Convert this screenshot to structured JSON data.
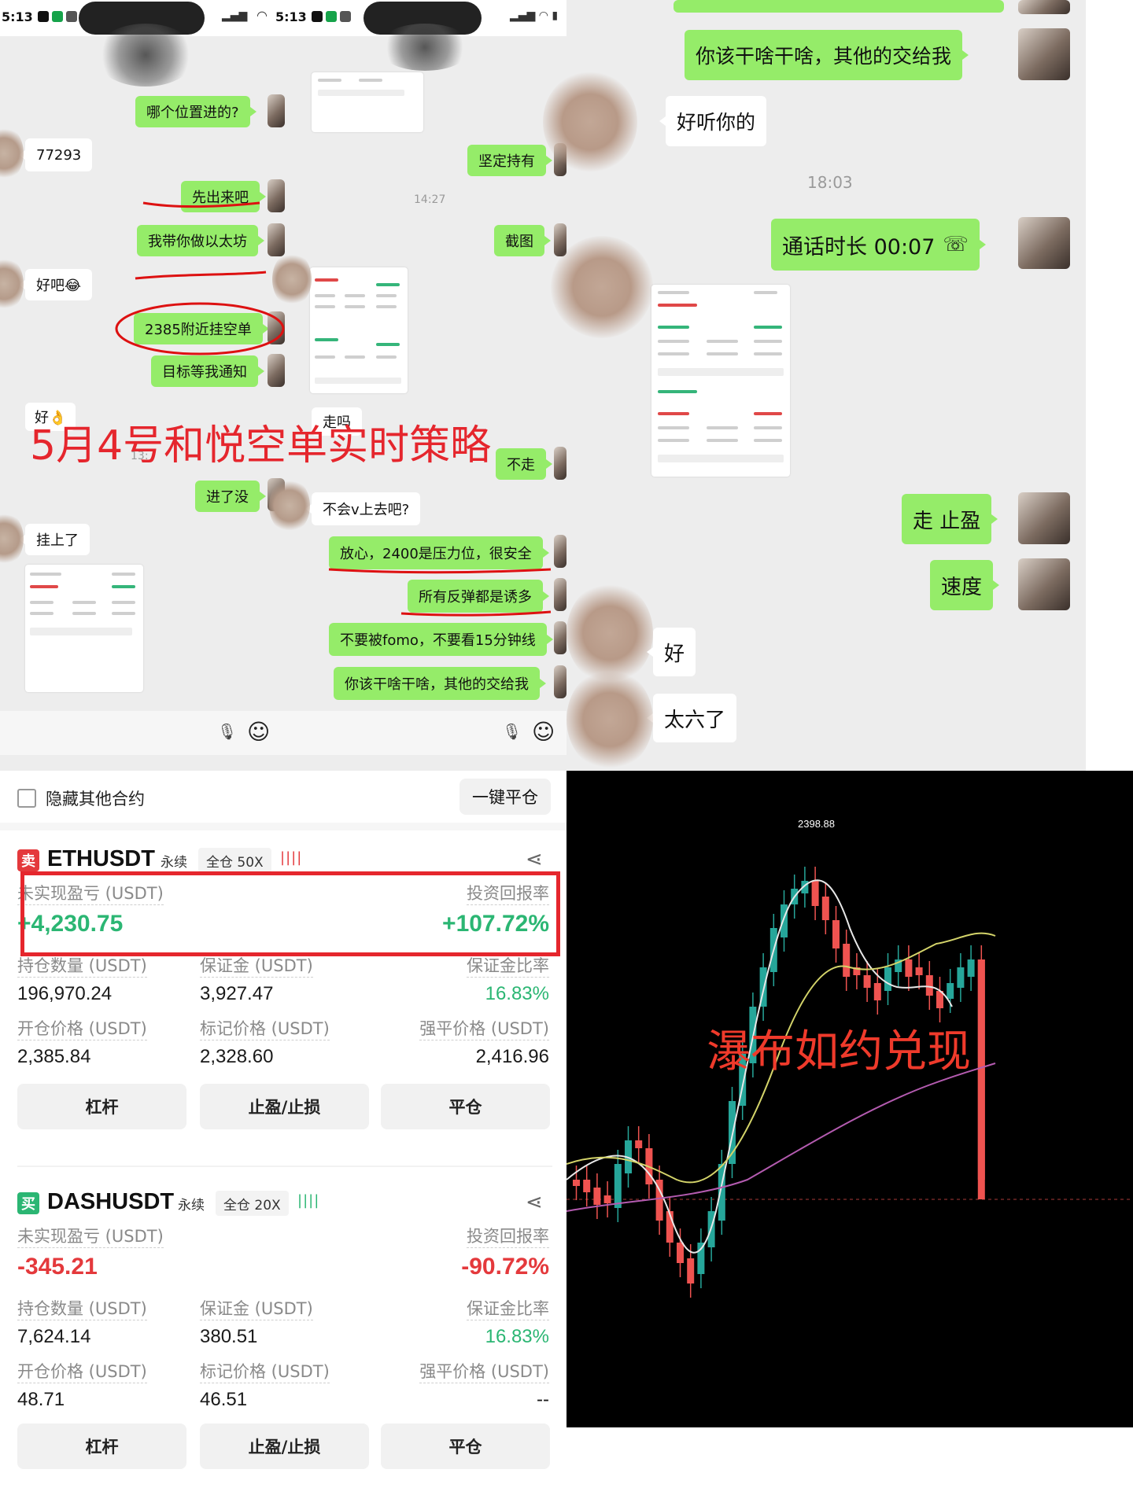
{
  "chat_left": {
    "messages": [
      {
        "side": "right",
        "text": "哪个位置进的?"
      },
      {
        "side": "left",
        "text": "77293"
      },
      {
        "side": "right",
        "text": "先出来吧"
      },
      {
        "side": "right",
        "text": "我带你做以太坊"
      },
      {
        "side": "left",
        "text": "好吧😂"
      },
      {
        "side": "right",
        "text": "2385附近挂空单"
      },
      {
        "side": "right",
        "text": "目标等我通知"
      },
      {
        "side": "left",
        "text": "好👌"
      },
      {
        "side": "right",
        "text": "进了没"
      },
      {
        "side": "left",
        "text": "挂上了"
      }
    ]
  },
  "chat_mid": {
    "time": "14:27",
    "time2": "13:",
    "messages": [
      {
        "side": "right",
        "text": "坚定持有"
      },
      {
        "side": "right",
        "text": "截图"
      },
      {
        "side": "left",
        "text": "走吗"
      },
      {
        "side": "right",
        "text": "不走"
      },
      {
        "side": "left",
        "text": "不会v上去吧?"
      },
      {
        "side": "right",
        "text": "放心，2400是压力位，很安全"
      },
      {
        "side": "right",
        "text": "所有反弹都是诱多"
      },
      {
        "side": "right",
        "text": "不要被fomo，不要看15分钟线"
      },
      {
        "side": "right",
        "text": "你该干啥干啥，其他的交给我"
      }
    ]
  },
  "status_left": {
    "time": "5:13"
  },
  "status_mid": {
    "time": "5:13"
  },
  "overlay_title": "5月4号和悦空单实时策略",
  "chat_right": {
    "time": "18:03",
    "messages": [
      {
        "side": "right",
        "text": "你该干啥干啥，其他的交给我"
      },
      {
        "side": "left",
        "text": "好听你的"
      },
      {
        "side": "right",
        "text": "通话时长 00:07"
      },
      {
        "side": "right",
        "text": "走 止盈"
      },
      {
        "side": "right",
        "text": "速度"
      },
      {
        "side": "left",
        "text": "好"
      },
      {
        "side": "left",
        "text": "太六了"
      }
    ]
  },
  "trading": {
    "hide_label": "隐藏其他合约",
    "close_all": "一键平仓",
    "positions": [
      {
        "side": "卖",
        "side_color": "#e4393c",
        "symbol": "ETHUSDT",
        "tag1": "永续",
        "tag2": "全仓 50X",
        "pnl_label": "未实现盈亏 (USDT)",
        "pnl": "+4,230.75",
        "roi_label": "投资回报率",
        "roi": "+107.72%",
        "color": "#2bb673",
        "size_label": "持仓数量 (USDT)",
        "size": "196,970.24",
        "margin_label": "保证金 (USDT)",
        "margin": "3,927.47",
        "ratio_label": "保证金比率",
        "ratio": "16.83%",
        "open_label": "开仓价格 (USDT)",
        "open": "2,385.84",
        "mark_label": "标记价格 (USDT)",
        "mark": "2,328.60",
        "liq_label": "强平价格 (USDT)",
        "liq": "2,416.96",
        "btn1": "杠杆",
        "btn2": "止盈/止损",
        "btn3": "平仓"
      },
      {
        "side": "买",
        "side_color": "#2bb673",
        "symbol": "DASHUSDT",
        "tag1": "永续",
        "tag2": "全仓 20X",
        "pnl_label": "未实现盈亏 (USDT)",
        "pnl": "-345.21",
        "roi_label": "投资回报率",
        "roi": "-90.72%",
        "color": "#e4393c",
        "size_label": "持仓数量 (USDT)",
        "size": "7,624.14",
        "margin_label": "保证金 (USDT)",
        "margin": "380.51",
        "ratio_label": "保证金比率",
        "ratio": "16.83%",
        "open_label": "开仓价格 (USDT)",
        "open": "48.71",
        "mark_label": "标记价格 (USDT)",
        "mark": "46.51",
        "liq_label": "强平价格 (USDT)",
        "liq": "--",
        "btn1": "杠杆",
        "btn2": "止盈/止损",
        "btn3": "平仓"
      }
    ]
  },
  "chart": {
    "high_label": "2398.88",
    "overlay_text": "瀑布如约兑现",
    "colors": {
      "up": "#26a69a",
      "down": "#ef5350"
    }
  },
  "icons": [
    "signal-icon",
    "wifi-icon",
    "battery-icon",
    "mic-icon",
    "emoji-icon",
    "share-icon",
    "checkbox-icon",
    "phone-icon"
  ]
}
